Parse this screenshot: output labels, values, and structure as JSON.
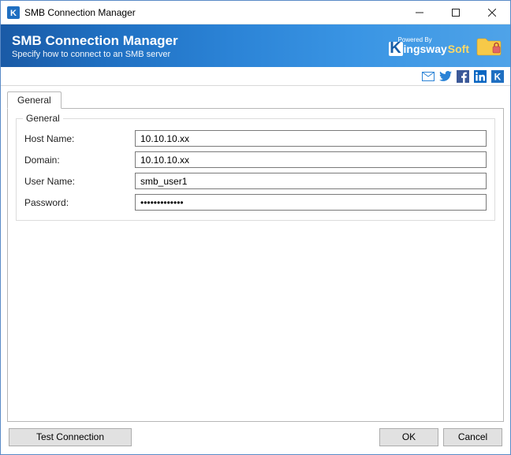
{
  "window": {
    "title": "SMB Connection Manager"
  },
  "header": {
    "title": "SMB Connection Manager",
    "subtitle": "Specify how to connect to an SMB server",
    "powered_label": "Powered By",
    "brand_part1": "ingsway",
    "brand_part2": "Soft"
  },
  "tabs": {
    "general": "General"
  },
  "fieldset": {
    "legend": "General",
    "host_label": "Host Name:",
    "host_value": "10.10.10.xx",
    "domain_label": "Domain:",
    "domain_value": "10.10.10.xx",
    "user_label": "User Name:",
    "user_value": "smb_user1",
    "password_label": "Password:",
    "password_value": "•••••••••••••"
  },
  "buttons": {
    "test": "Test Connection",
    "ok": "OK",
    "cancel": "Cancel"
  }
}
